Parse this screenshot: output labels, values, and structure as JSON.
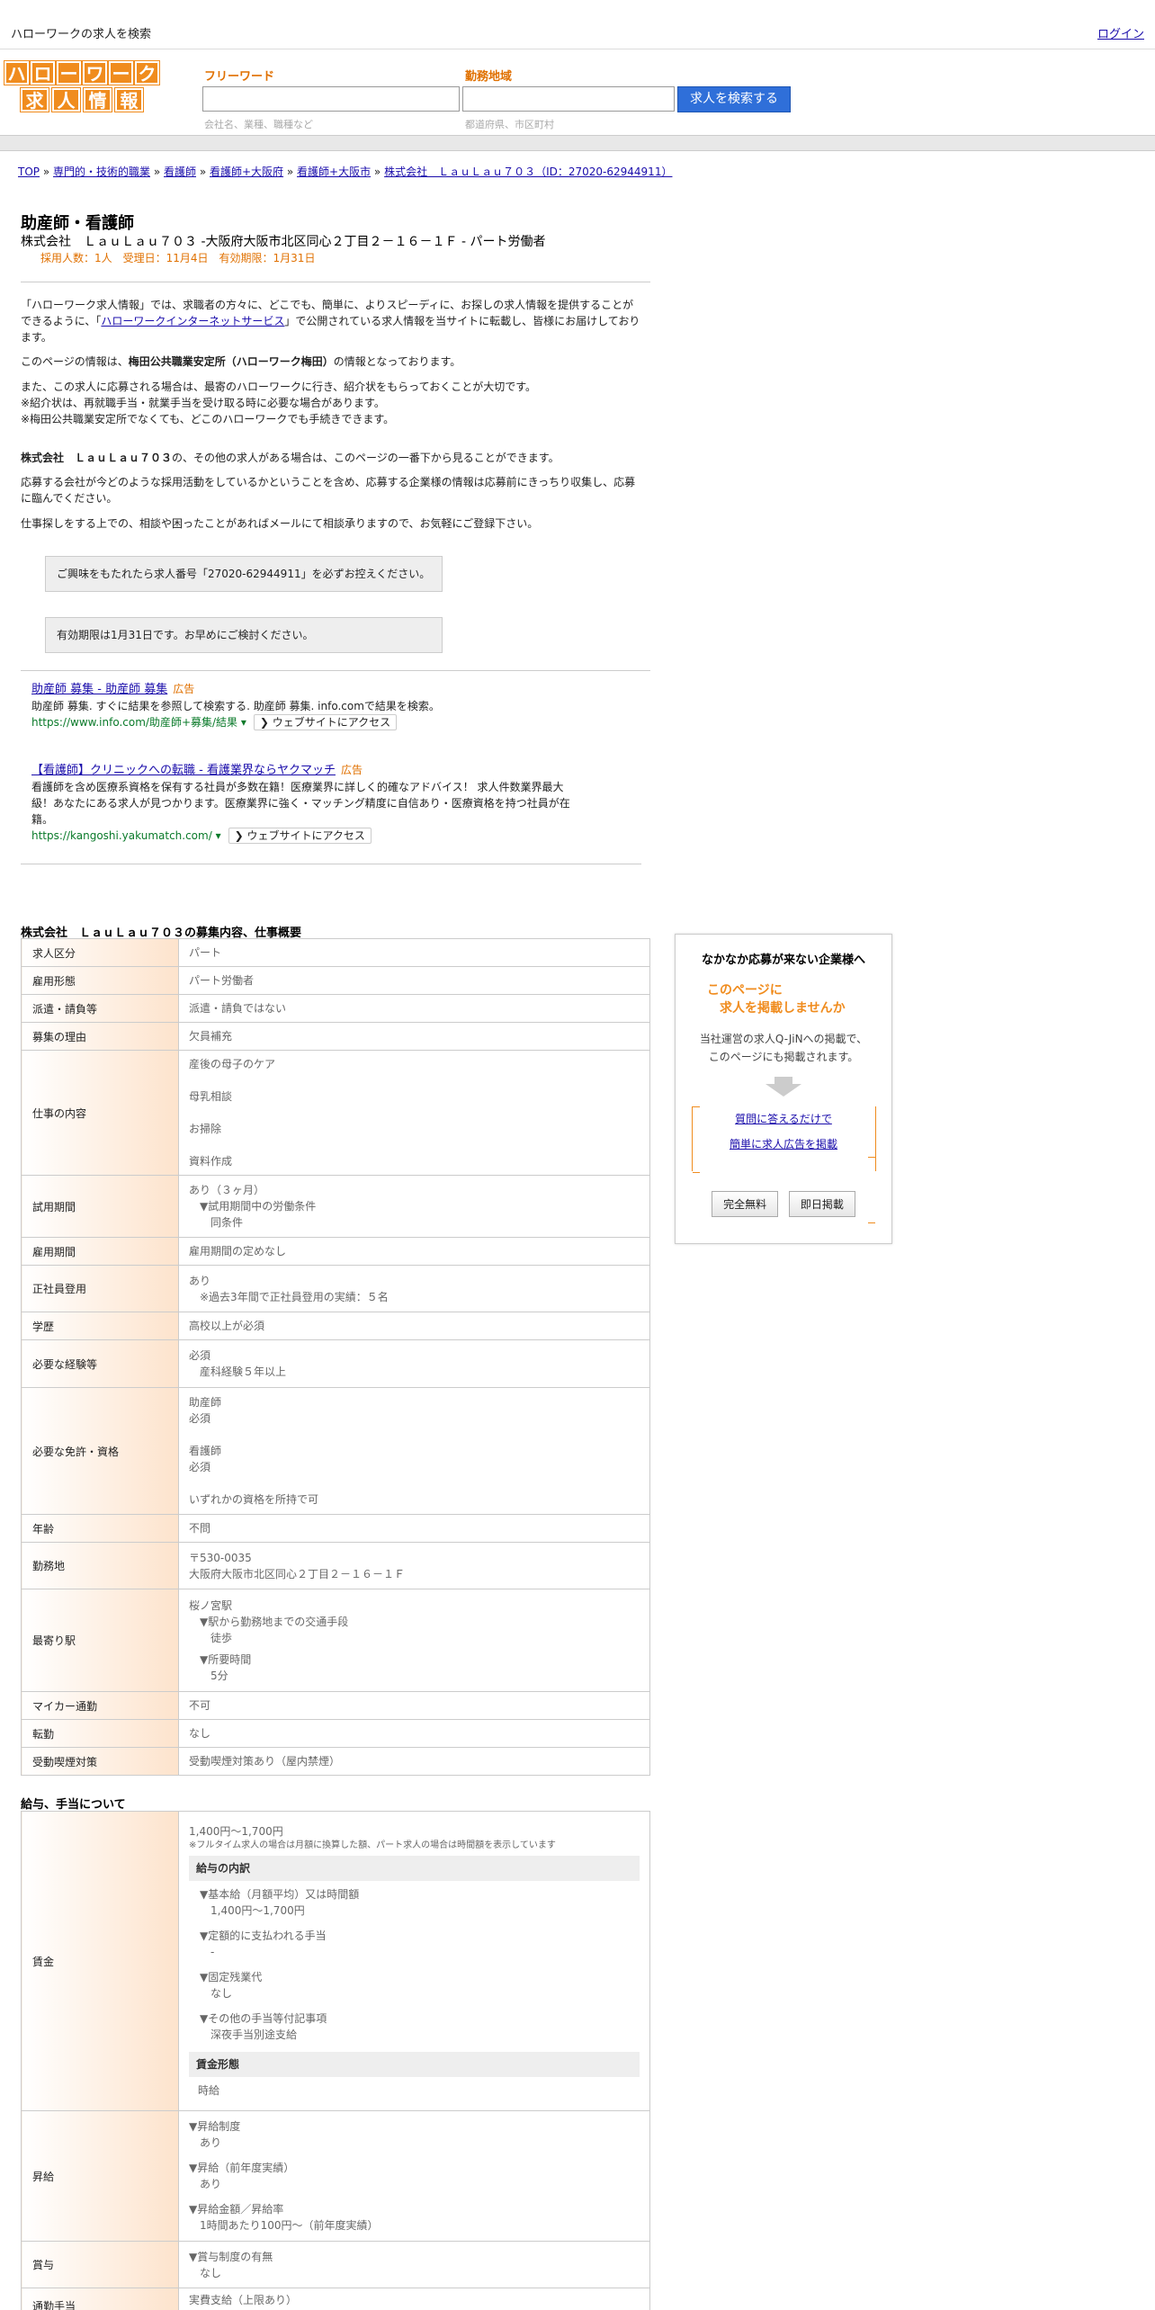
{
  "header": {
    "title": "ハローワークの求人を検索",
    "login": "ログイン"
  },
  "logo": {
    "row1": [
      "ハ",
      "ロ",
      "ー",
      "ワ",
      "ー",
      "ク"
    ],
    "row2": [
      "求",
      "人",
      "情",
      "報"
    ]
  },
  "search": {
    "keyword_label": "フリーワード",
    "keyword_placeholder": "会社名、業種、職種など",
    "area_label": "勤務地域",
    "area_placeholder": "都道府県、市区町村",
    "button": "求人を検索する"
  },
  "breadcrumb": [
    "TOP",
    "専門的・技術的職業",
    "看護師",
    "看護師+大阪府",
    "看護師+大阪市",
    "株式会社　ＬａｕＬａｕ７０３（ID：27020-62944911）"
  ],
  "job": {
    "title": "助産師・看護師",
    "subtitle": "株式会社　ＬａｕＬａｕ７０３ -大阪府大阪市北区同心２丁目２－１６－１Ｆ - パート労働者",
    "meta": "採用人数：1人　受理日：11月4日　有効期限：1月31日"
  },
  "intro": {
    "p1_a": "「ハローワーク求人情報」では、求職者の方々に、どこでも、簡単に、よりスピーディに、お探しの求人情報を提供することができるように、「",
    "p1_link": "ハローワークインターネットサービス",
    "p1_b": "」で公開されている求人情報を当サイトに転載し、皆様にお届けしております。",
    "p2_a": "このページの情報は、",
    "p2_bold": "梅田公共職業安定所（ハローワーク梅田）",
    "p2_b": "の情報となっております。",
    "p3_1": "また、この求人に応募される場合は、最寄のハローワークに行き、紹介状をもらっておくことが大切です。",
    "p3_2": "※紹介状は、再就職手当・就業手当を受け取る時に必要な場合があります。",
    "p3_3": "※梅田公共職業安定所でなくても、どこのハローワークでも手続きできます。",
    "p4_bold": "株式会社　ＬａｕＬａｕ７０３",
    "p4_b": "の、その他の求人がある場合は、このページの一番下から見ることができます。",
    "p5": "応募する会社が今どのような採用活動をしているかということを含め、応募する企業様の情報は応募前にきっちり収集し、応募に臨んでください。",
    "p6": "仕事探しをする上での、相談や困ったことがあればメールにて相談承りますので、お気軽にご登録下さい。",
    "notice1": "ご興味をもたれたら求人番号「27020-62944911」を必ずお控えください。",
    "notice2": "有効期限は1月31日です。お早めにご検討ください。"
  },
  "ads": [
    {
      "title": "助産師 募集 - 助産師 募集",
      "tag": "広告",
      "text": "助産師 募集. すぐに結果を参照して検索する. 助産師 募集. info.comで結果を検索。",
      "url": "https://www.info.com/助産師+募集/結果 ▾",
      "visit": "❯ ウェブサイトにアクセス"
    },
    {
      "title": "【看護師】クリニックへの転職 - 看護業界ならヤクマッチ",
      "tag": "広告",
      "text": "看護師を含め医療系資格を保有する社員が多数在籍！医療業界に詳しく的確なアドバイス！ 求人件数業界最大級！あなたにある求人が見つかります。医療業界に強く・マッチング精度に自信あり・医療資格を持つ社員が在籍。",
      "url": "https://kangoshi.yakumatch.com/ ▾",
      "visit": "❯ ウェブサイトにアクセス"
    }
  ],
  "spec": {
    "title": "株式会社　ＬａｕＬａｕ７０３の募集内容、仕事概要",
    "rows": {
      "kubun": {
        "label": "求人区分",
        "value": "パート"
      },
      "koyo": {
        "label": "雇用形態",
        "value": "パート労働者"
      },
      "haken": {
        "label": "派遣・請負等",
        "value": "派遣・請負ではない"
      },
      "riyu": {
        "label": "募集の理由",
        "value": "欠員補充"
      },
      "shigoto": {
        "label": "仕事の内容",
        "l1": "産後の母子のケア",
        "l2": "母乳相談",
        "l3": "お掃除",
        "l4": "資料作成"
      },
      "shiyo": {
        "label": "試用期間",
        "l1": "あり（３ヶ月）",
        "l2": "▼試用期間中の労働条件",
        "l3": "同条件"
      },
      "kikan": {
        "label": "雇用期間",
        "value": "雇用期間の定めなし"
      },
      "seishain": {
        "label": "正社員登用",
        "l1": "あり",
        "l2": "※過去3年間で正社員登用の実績：５名"
      },
      "gakureki": {
        "label": "学歴",
        "value": "高校以上が必須"
      },
      "keiken": {
        "label": "必要な経験等",
        "l1": "必須",
        "l2": "産科経験５年以上"
      },
      "shikaku": {
        "label": "必要な免許・資格",
        "l1": "助産師",
        "l2": "必須",
        "l3": "看護師",
        "l4": "必須",
        "l5": "いずれかの資格を所持で可"
      },
      "nenrei": {
        "label": "年齢",
        "value": "不問"
      },
      "kinmuchi": {
        "label": "勤務地",
        "l1": "〒530-0035",
        "l2": "大阪府大阪市北区同心２丁目２－１６－１Ｆ"
      },
      "eki": {
        "label": "最寄り駅",
        "l1": "桜ノ宮駅",
        "l2": "▼駅から勤務地までの交通手段",
        "l3": "徒歩",
        "l4": "▼所要時間",
        "l5": "5分"
      },
      "mycar": {
        "label": "マイカー通勤",
        "value": "不可"
      },
      "tenkin": {
        "label": "転勤",
        "value": "なし"
      },
      "judo": {
        "label": "受動喫煙対策",
        "value": "受動喫煙対策あり（屋内禁煙）"
      }
    }
  },
  "salary": {
    "title": "給与、手当について",
    "chingin": {
      "label": "賃金",
      "range": "1,400円〜1,700円",
      "note": "※フルタイム求人の場合は月額に換算した額、パート求人の場合は時間額を表示しています",
      "box1": "給与の内訳",
      "k1": "▼基本給（月額平均）又は時間額",
      "v1": "1,400円〜1,700円",
      "k2": "▼定額的に支払われる手当",
      "v2": "-",
      "k3": "▼固定残業代",
      "v3": "なし",
      "k4": "▼その他の手当等付記事項",
      "v4": "深夜手当別途支給",
      "box2": "賃金形態",
      "v5": "時給"
    },
    "shokyu": {
      "label": "昇給",
      "k1": "▼昇給制度",
      "v1": "あり",
      "k2": "▼昇給（前年度実績）",
      "v2": "あり",
      "k3": "▼昇給金額／昇給率",
      "v3": "1時間あたり100円〜（前年度実績）"
    },
    "shoyo": {
      "label": "賞与",
      "k1": "▼賞与制度の有無",
      "v1": "なし"
    },
    "tsukin": {
      "label": "通勤手当",
      "v1": "実費支給（上限あり）"
    }
  },
  "sidebar": {
    "heading": "なかなか応募が来ない企業様へ",
    "offer1": "このページに",
    "offer2": "求人を掲載しませんか",
    "text1": "当社運営の求人Q-JiNへの掲載で、",
    "text2": "このページにも掲載されます。",
    "link1": "質問に答えるだけで",
    "link2": "簡単に求人広告を掲載",
    "btn1": "完全無料",
    "btn2": "即日掲載"
  }
}
